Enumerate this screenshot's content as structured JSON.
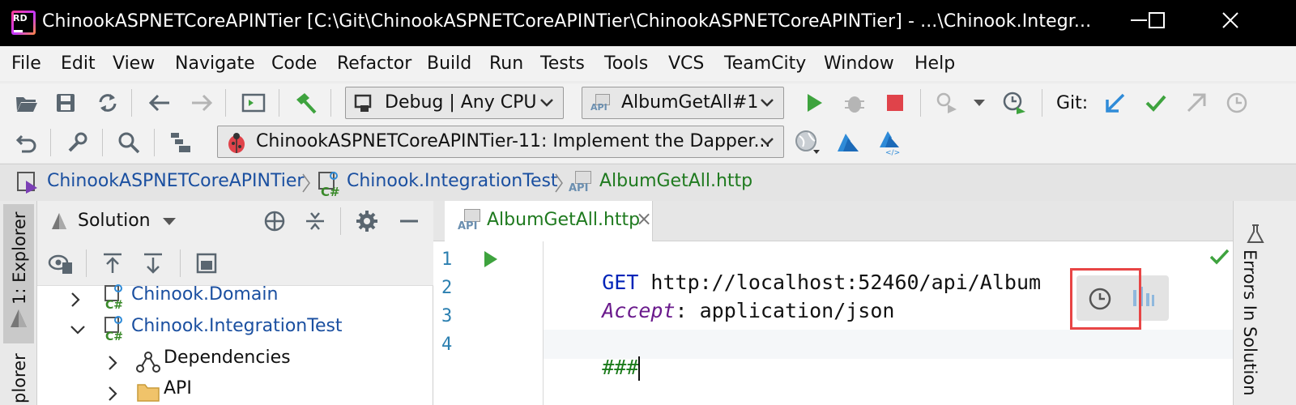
{
  "window": {
    "title": "ChinookASPNETCoreAPINTier [C:\\Git\\ChinookASPNETCoreAPINTier\\ChinookASPNETCoreAPINTier] - ...\\Chinook.Integr...",
    "logo_text": "RD",
    "minimize": "—",
    "maximize": "☐",
    "close": "✕"
  },
  "menu": [
    "File",
    "Edit",
    "View",
    "Navigate",
    "Code",
    "Refactor",
    "Build",
    "Run",
    "Tests",
    "Tools",
    "VCS",
    "TeamCity",
    "Window",
    "Help"
  ],
  "toolbar": {
    "configuration": "Debug | Any CPU",
    "run_config": "AlbumGetAll#1",
    "run_config_badge": "API",
    "git_label": "Git:",
    "task": "ChinookASPNETCoreAPINTier-11: Implement the Dapper..."
  },
  "breadcrumb": {
    "solution": "ChinookASPNETCoreAPINTier",
    "project": "Chinook.IntegrationTest",
    "file": "AlbumGetAll.http",
    "file_badge": "API"
  },
  "left_strip": {
    "explorer_tab": "1: Explorer",
    "explorer_tab_2": "plorer"
  },
  "solution_panel": {
    "title": "Solution",
    "tree": [
      {
        "label": "Chinook.Domain",
        "expanded": false
      },
      {
        "label": "Chinook.IntegrationTest",
        "expanded": true
      },
      {
        "label": "Dependencies",
        "expanded": false
      },
      {
        "label": "API",
        "expanded": false
      }
    ]
  },
  "editor": {
    "tab_label": "AlbumGetAll.http",
    "tab_badge": "API",
    "tab_close": "×",
    "line_numbers": [
      "1",
      "2",
      "3",
      "4"
    ],
    "lines": {
      "l1_method": "GET",
      "l1_url": " http://localhost:52460/api/Album",
      "l2_header": "Accept",
      "l2_value": ": application/json",
      "l4_sep": "###"
    }
  },
  "right_strip": {
    "errors_tab": "Errors In Solution"
  },
  "colors": {
    "accent_green": "#3ea33e",
    "stop_red": "#e0434a",
    "git_blue": "#2f8bd8",
    "highlight_box": "#e84545"
  }
}
